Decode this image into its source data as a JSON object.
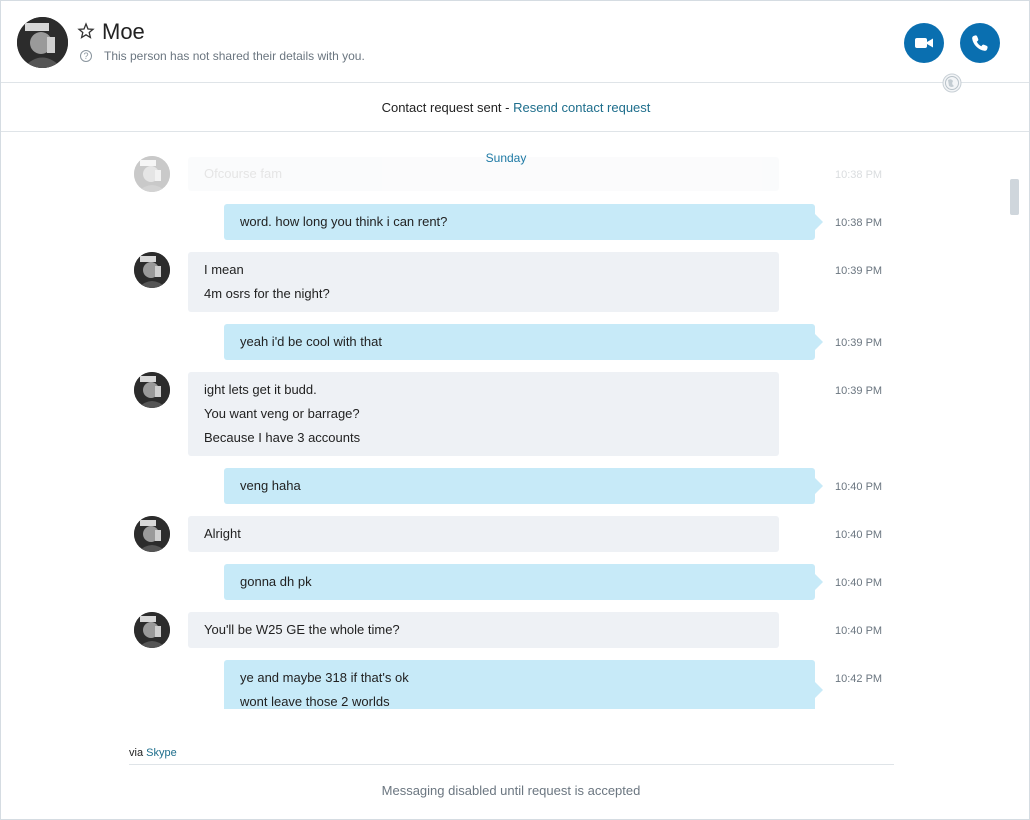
{
  "header": {
    "contact_name": "Moe",
    "details_note": "This person has not shared their details with you.",
    "video_call_icon": "video-camera-icon",
    "audio_call_icon": "phone-icon",
    "favorite_icon": "star-outline-icon",
    "status_icon": "globe-icon"
  },
  "request_bar": {
    "text": "Contact request sent - ",
    "resend_label": "Resend contact request"
  },
  "chat": {
    "date_separator": "Sunday",
    "messages": [
      {
        "side": "in",
        "lines": [
          "Ofcourse fam"
        ],
        "time": "10:38 PM"
      },
      {
        "side": "out",
        "lines": [
          "word. how long you think i can rent?"
        ],
        "time": "10:38 PM"
      },
      {
        "side": "in",
        "lines": [
          "I mean",
          "4m osrs for the night?"
        ],
        "time": "10:39 PM"
      },
      {
        "side": "out",
        "lines": [
          "yeah i'd be cool with that"
        ],
        "time": "10:39 PM"
      },
      {
        "side": "in",
        "lines": [
          "ight lets get it budd.",
          "You want veng or barrage?",
          "Because I have 3 accounts"
        ],
        "time": "10:39 PM"
      },
      {
        "side": "out",
        "lines": [
          "veng haha"
        ],
        "time": "10:40 PM"
      },
      {
        "side": "in",
        "lines": [
          "Alright"
        ],
        "time": "10:40 PM"
      },
      {
        "side": "out",
        "lines": [
          "gonna dh pk"
        ],
        "time": "10:40 PM"
      },
      {
        "side": "in",
        "lines": [
          "You'll be W25 GE the whole time?"
        ],
        "time": "10:40 PM"
      },
      {
        "side": "out",
        "lines": [
          "ye and maybe 318 if that's ok",
          "wont leave those 2 worlds"
        ],
        "time": "10:42 PM"
      }
    ]
  },
  "footer": {
    "via_prefix": "via ",
    "via_link": "Skype",
    "disabled_message": "Messaging disabled until request is accepted"
  },
  "colors": {
    "accent": "#0a6fb0",
    "link": "#1e6e8c",
    "incoming_bubble": "#eef1f5",
    "outgoing_bubble": "#c7eaf8"
  }
}
